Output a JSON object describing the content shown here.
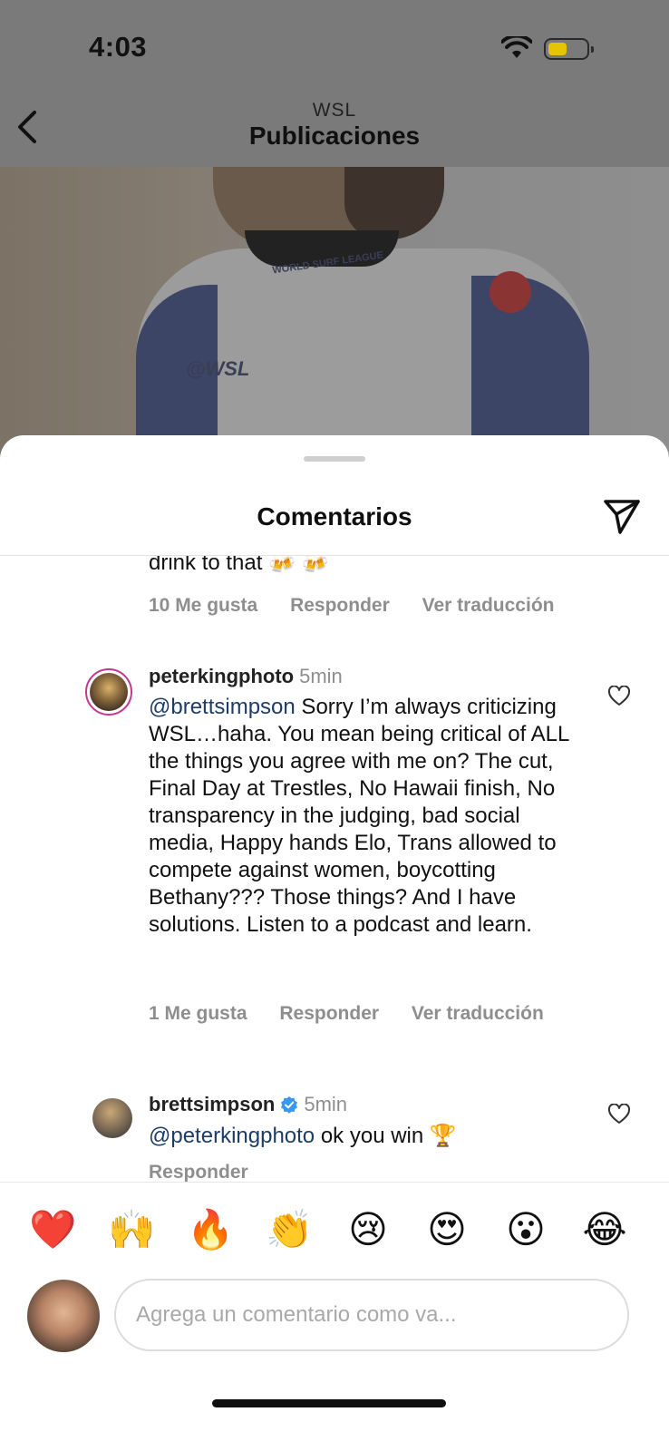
{
  "status_bar": {
    "time": "4:03"
  },
  "nav": {
    "subtitle": "WSL",
    "title": "Publicaciones"
  },
  "photo": {
    "jersey_text": "WORLD SURF LEAGUE",
    "jersey_logo": "@WSL"
  },
  "sheet": {
    "title": "Comentarios"
  },
  "comments": [
    {
      "text": "drink to that 🍻 🍻",
      "likes": "10 Me gusta",
      "reply": "Responder",
      "translate": "Ver traducción"
    },
    {
      "username": "peterkingphoto",
      "time": "5min",
      "mention": "@brettsimpson",
      "text": " Sorry I’m always criticizing WSL…haha. You mean being critical of ALL the things you agree with me on? The cut, Final Day at Trestles, No Hawaii finish, No transparency in the judging, bad social media, Happy hands Elo, Trans allowed to compete against women, boycotting Bethany??? Those things? And I have solutions. Listen to a podcast and learn.",
      "likes": "1 Me gusta",
      "reply": "Responder",
      "translate": "Ver traducción"
    },
    {
      "username": "brettsimpson",
      "verified": true,
      "time": "5min",
      "mention": "@peterkingphoto",
      "text": " ok you win 🏆",
      "reply": "Responder"
    }
  ],
  "emoji_bar": [
    "❤️",
    "🙌",
    "🔥",
    "👏",
    "😢",
    "😍",
    "😮",
    "😂"
  ],
  "composer": {
    "placeholder": "Agrega un comentario como va..."
  },
  "colors": {
    "mention": "#1d3d68",
    "verified": "#3897f0",
    "heart_emoji": "#e2172b"
  }
}
